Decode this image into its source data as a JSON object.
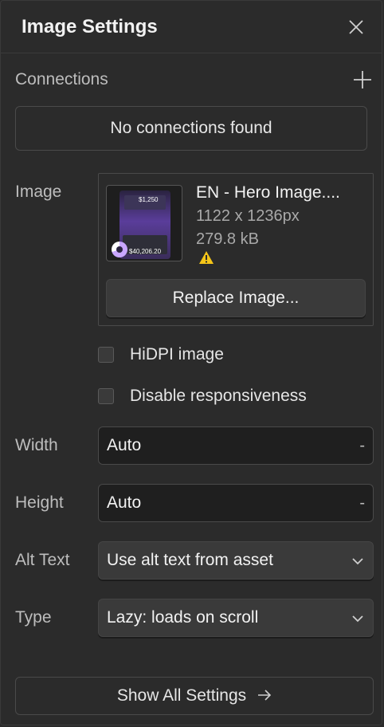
{
  "header": {
    "title": "Image Settings",
    "close_icon": "close-icon"
  },
  "connections": {
    "label": "Connections",
    "add_icon": "plus-icon",
    "empty_text": "No connections found"
  },
  "image": {
    "label": "Image",
    "file_name": "EN - Hero Image....",
    "dimensions": "1122 x 1236px",
    "file_size": "279.8 kB",
    "warning_icon": "warning-icon",
    "thumbnail_price_top": "$1,250",
    "thumbnail_price_bottom": "$40,206.20",
    "replace_label": "Replace Image..."
  },
  "options": {
    "hidpi_label": "HiDPI image",
    "hidpi_checked": false,
    "disable_responsive_label": "Disable responsiveness",
    "disable_responsive_checked": false
  },
  "width": {
    "label": "Width",
    "value": "Auto",
    "unit": "-"
  },
  "height": {
    "label": "Height",
    "value": "Auto",
    "unit": "-"
  },
  "alt_text": {
    "label": "Alt Text",
    "selected": "Use alt text from asset"
  },
  "type": {
    "label": "Type",
    "selected": "Lazy: loads on scroll"
  },
  "footer": {
    "show_all_label": "Show All Settings",
    "arrow_icon": "arrow-right-icon"
  },
  "colors": {
    "background": "#2b2b2b",
    "warning": "#f5c518",
    "accent_thumb": "#5a3d9a"
  }
}
